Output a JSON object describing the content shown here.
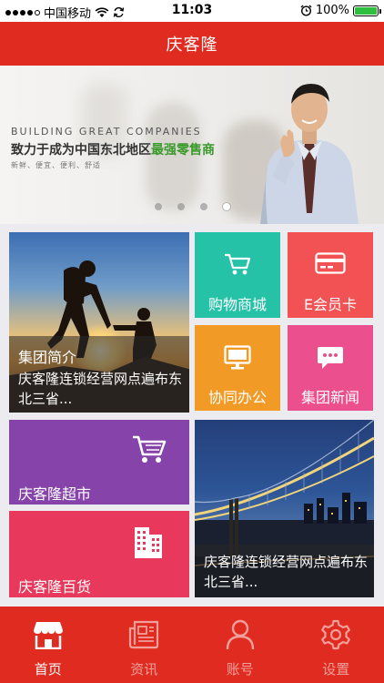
{
  "status_bar": {
    "carrier": "中国移动",
    "time": "11:03",
    "battery_text": "100%",
    "battery_level": 1.0
  },
  "header": {
    "title": "庆客隆"
  },
  "banner": {
    "tagline_en": "BUILDING  GREAT  COMPANIES",
    "tagline_cn_prefix": "致力于成为中国东北地区",
    "tagline_cn_highlight": "最强零售商",
    "tagline_sub": "新鲜、便宜、便利、舒适",
    "slide_count": 4,
    "active_slide": 4
  },
  "tiles": {
    "intro": {
      "title": "集团简介",
      "desc": "庆客隆连锁经营网点遍布东北三省..."
    },
    "shop": {
      "label": "购物商城",
      "icon": "cart-icon"
    },
    "card": {
      "label": "E会员卡",
      "icon": "card-icon"
    },
    "office": {
      "label": "协同办公",
      "icon": "monitor-icon"
    },
    "news": {
      "label": "集团新闻",
      "icon": "chat-icon"
    },
    "supermarket": {
      "label": "庆客隆超市",
      "icon": "cart-icon"
    },
    "department": {
      "label": "庆客隆百货",
      "icon": "building-icon"
    },
    "bridge": {
      "desc": "庆客隆连锁经营网点遍布东北三省..."
    }
  },
  "tab_bar": {
    "items": [
      {
        "label": "首页",
        "icon": "store-icon",
        "active": true
      },
      {
        "label": "资讯",
        "icon": "newspaper-icon",
        "active": false
      },
      {
        "label": "账号",
        "icon": "person-icon",
        "active": false
      },
      {
        "label": "设置",
        "icon": "gear-icon",
        "active": false
      }
    ]
  },
  "colors": {
    "brand_red": "#e02b20",
    "teal": "#25c2a8",
    "coral": "#f35254",
    "orange": "#f19a26",
    "pink": "#ec4f8d",
    "purple": "#8643a9",
    "crimson": "#e8385b"
  }
}
